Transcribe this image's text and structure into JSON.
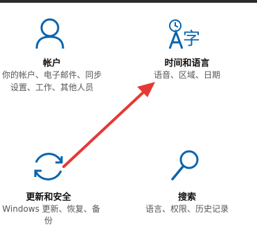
{
  "settings_tiles": [
    {
      "icon": "person-icon",
      "title": "帐户",
      "description_lines": [
        "你的帐户、电子邮件、同步",
        "设置、工作、其他人员"
      ]
    },
    {
      "icon": "time-language-icon",
      "icon_glyph": "字",
      "title": "时间和语言",
      "description_lines": [
        "语音、区域、日期"
      ]
    },
    {
      "icon": "sync-icon",
      "title": "更新和安全",
      "description_lines": [
        "Windows 更新、恢复、备",
        "份"
      ]
    },
    {
      "icon": "search-icon",
      "title": "搜索",
      "description_lines": [
        "语言、权限、历史记录"
      ]
    }
  ],
  "annotation": {
    "icon": "red-arrow",
    "color": "#e53935"
  },
  "colors": {
    "accent": "#0a64ad",
    "title": "#111111",
    "description": "#555555"
  }
}
